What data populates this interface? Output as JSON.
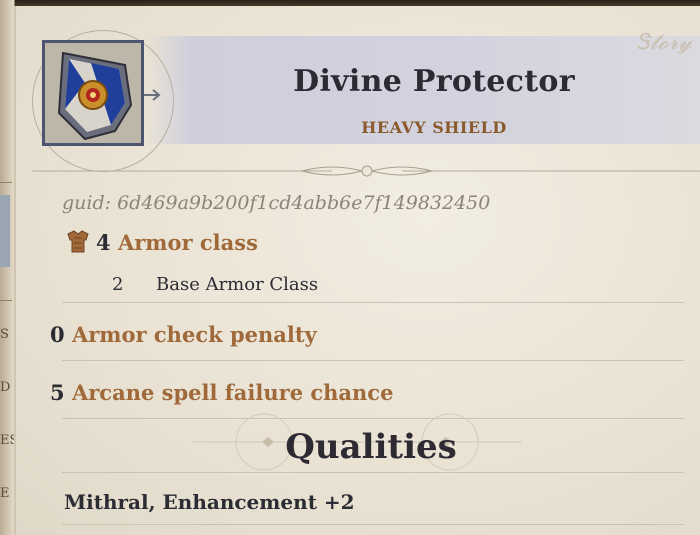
{
  "item": {
    "name": "Divine Protector",
    "type": "HEAVY SHIELD",
    "guid": "guid: 6d469a9b200f1cd4abb6e7f149832450",
    "icon": "shield-icon"
  },
  "stats": {
    "armor_class": {
      "value": "4",
      "label": "Armor class",
      "icon": "armor-icon"
    },
    "base_armor": {
      "value": "2",
      "label": "Base Armor Class"
    },
    "check_penalty": {
      "value": "0",
      "label": "Armor check penalty"
    },
    "spell_failure": {
      "value": "5",
      "label": "Arcane spell failure chance"
    }
  },
  "qualities": {
    "title": "Qualities",
    "text": "Mithral, Enhancement +2"
  },
  "side_letters": [
    "S",
    "D",
    "ES",
    "E"
  ],
  "colors": {
    "accent": "#a0693a",
    "subtitle": "#8a5a2b",
    "text": "#2b2b33",
    "panel": "#ece6d9"
  }
}
